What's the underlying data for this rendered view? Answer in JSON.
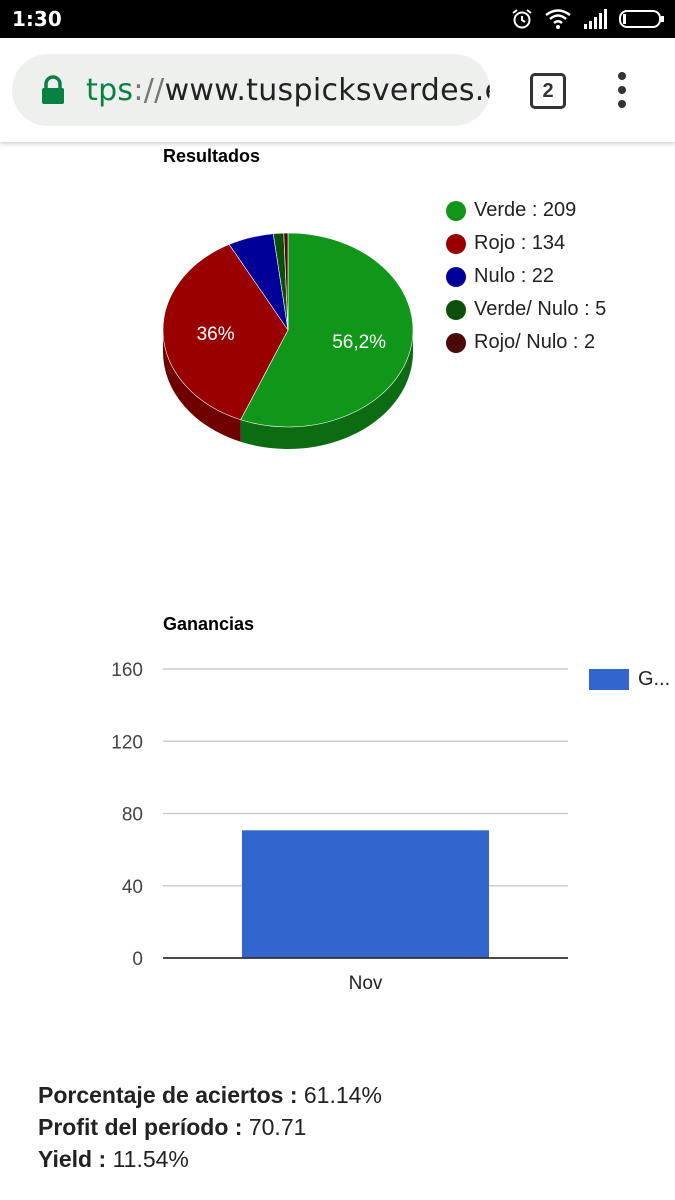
{
  "status_bar": {
    "time": "1:30"
  },
  "browser": {
    "url_scheme": "tps",
    "url_sep": "://",
    "url_host": "www.tuspicksverdes.es",
    "tab_count": "2"
  },
  "chart_data": [
    {
      "type": "pie",
      "title": "Resultados",
      "slices": [
        {
          "name": "Verde",
          "value": 209,
          "color": "#109618",
          "legend": "Verde : 209"
        },
        {
          "name": "Rojo",
          "value": 134,
          "color": "#990000",
          "legend": "Rojo : 134"
        },
        {
          "name": "Nulo",
          "value": 22,
          "color": "#000099",
          "legend": "Nulo : 22"
        },
        {
          "name": "Verde/ Nulo",
          "value": 5,
          "color": "#0b4f0b",
          "legend": "Verde/ Nulo : 5"
        },
        {
          "name": "Rojo/ Nulo",
          "value": 2,
          "color": "#4a0a0a",
          "legend": "Rojo/ Nulo : 2"
        }
      ],
      "slice_labels": [
        "56,2%",
        "36%"
      ],
      "legend_position": "right"
    },
    {
      "type": "bar",
      "title": "Ganancias",
      "categories": [
        "Nov"
      ],
      "series": [
        {
          "name": "G...",
          "values": [
            70.71
          ],
          "color": "#3366cc"
        }
      ],
      "yticks": [
        0,
        40,
        80,
        120,
        160
      ],
      "ylim": [
        0,
        160
      ],
      "grid": true,
      "legend_position": "right"
    }
  ],
  "summary": {
    "accuracy_label": "Porcentaje de aciertos :",
    "accuracy_value": "61.14%",
    "profit_label": "Profit del período :",
    "profit_value": "70.71",
    "yield_label": "Yield :",
    "yield_value": "11.54%"
  }
}
